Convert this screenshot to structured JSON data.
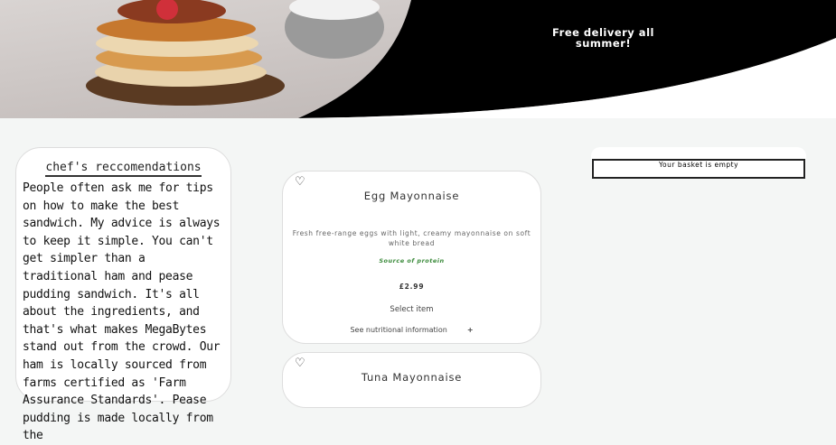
{
  "header": {
    "promo": "Free delivery all summer!"
  },
  "chef": {
    "title": "chef's reccomendations",
    "text": "People often ask me for tips on how to make the best sandwich. My advice is always to keep it simple. You can't get simpler than a traditional ham and pease pudding sandwich. It's all about the ingredients, and that's what makes MegaBytes stand out from the crowd. Our ham is locally sourced from farms certified as 'Farm Assurance Standards'. Pease pudding is made locally from the"
  },
  "products": [
    {
      "name": "Egg Mayonnaise",
      "description": "Fresh free-range eggs with light, creamy mayonnaise on soft white bread",
      "tag": "Source of protein",
      "price": "£2.99",
      "select": "Select item",
      "nutrition": "See nutritional information",
      "expand": "+"
    },
    {
      "name": "Tuna Mayonnaise"
    }
  ],
  "basket": {
    "status": "Your basket is empty"
  }
}
